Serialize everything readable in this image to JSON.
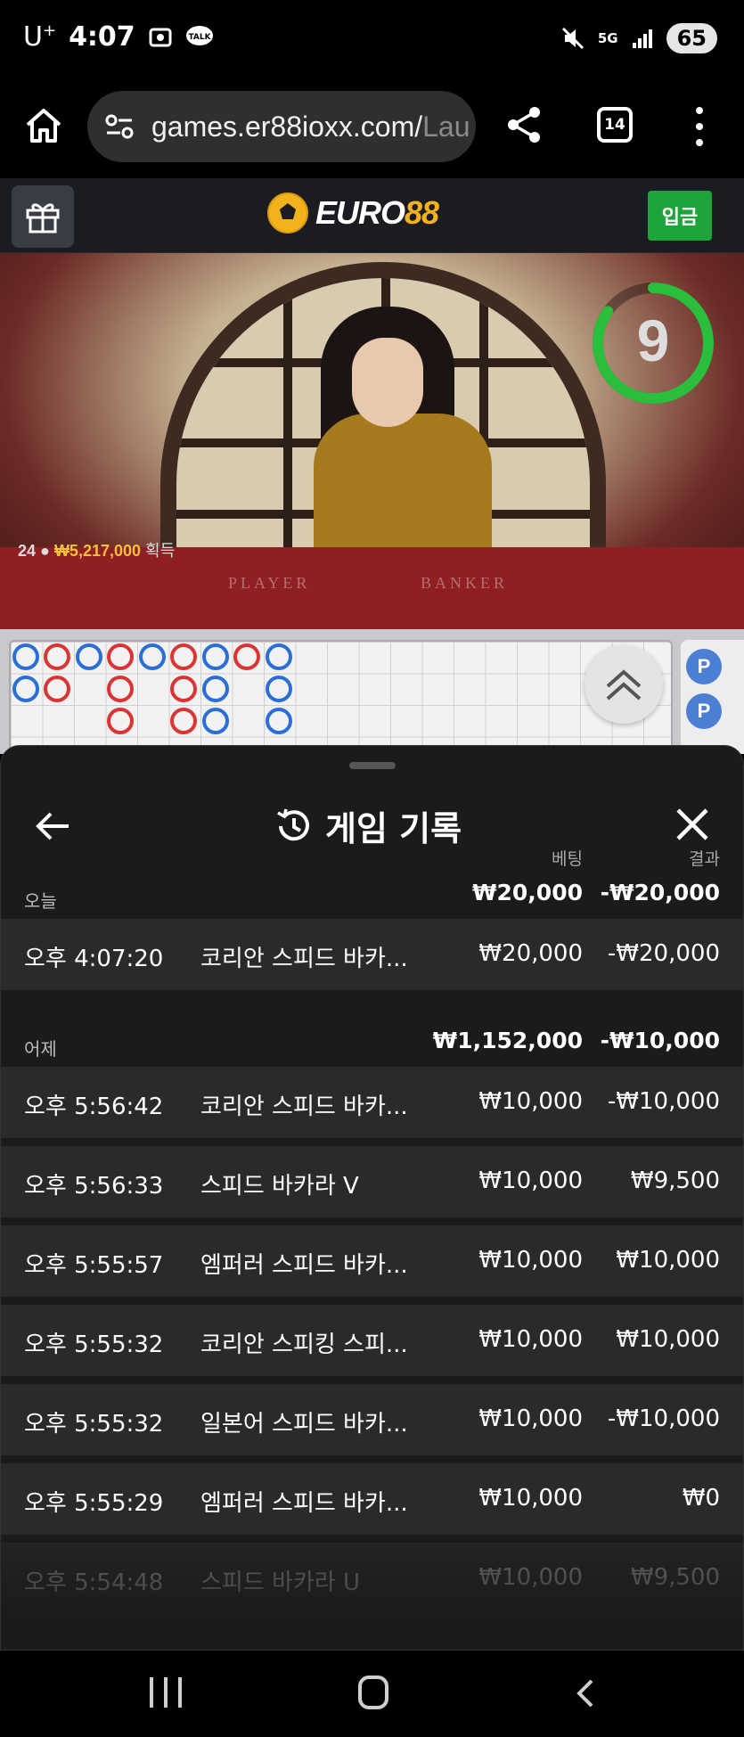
{
  "status_bar": {
    "carrier": "U",
    "carrier_suffix": "+",
    "time": "4:07",
    "network": "5G",
    "battery": "65"
  },
  "browser": {
    "url_main": "games.er88ioxx.com/",
    "url_fade": "Lau",
    "tab_count": "14"
  },
  "site": {
    "brand_white": "EURO",
    "brand_yellow": "88",
    "deposit_label": "입금"
  },
  "live": {
    "countdown": "9",
    "winner_count": "24",
    "winner_amount": "₩5,217,000",
    "winner_label": "획득",
    "table_player": "PLAYER",
    "table_banker": "BANKER"
  },
  "roadmap": {
    "side_chips": [
      "P",
      "P"
    ]
  },
  "history": {
    "title": "게임 기록",
    "col_bet": "베팅",
    "col_result": "결과",
    "days": [
      {
        "label": "오늘",
        "total_bet": "₩20,000",
        "total_result": "-₩20,000",
        "records": [
          {
            "time": "오후 4:07:20",
            "game": "코리안 스피드 바카...",
            "bet": "₩20,000",
            "result": "-₩20,000"
          }
        ]
      },
      {
        "label": "어제",
        "total_bet": "₩1,152,000",
        "total_result": "-₩10,000",
        "records": [
          {
            "time": "오후 5:56:42",
            "game": "코리안 스피드 바카...",
            "bet": "₩10,000",
            "result": "-₩10,000"
          },
          {
            "time": "오후 5:56:33",
            "game": "스피드 바카라 V",
            "bet": "₩10,000",
            "result": "₩9,500"
          },
          {
            "time": "오후 5:55:57",
            "game": "엠퍼러 스피드 바카...",
            "bet": "₩10,000",
            "result": "₩10,000"
          },
          {
            "time": "오후 5:55:32",
            "game": "코리안 스피킹 스피...",
            "bet": "₩10,000",
            "result": "₩10,000"
          },
          {
            "time": "오후 5:55:32",
            "game": "일본어 스피드 바카...",
            "bet": "₩10,000",
            "result": "-₩10,000"
          },
          {
            "time": "오후 5:55:29",
            "game": "엠퍼러 스피드 바카...",
            "bet": "₩10,000",
            "result": "₩0"
          },
          {
            "time": "오후 5:54:48",
            "game": "스피드 바카라 U",
            "bet": "₩10,000",
            "result": "₩9,500"
          }
        ]
      }
    ]
  },
  "colors": {
    "deposit_green": "#1ea43d",
    "brand_yellow": "#f2b21c",
    "timer_green": "#2bbd3c",
    "banker_red": "#d93535",
    "player_blue": "#2b6fd6"
  }
}
